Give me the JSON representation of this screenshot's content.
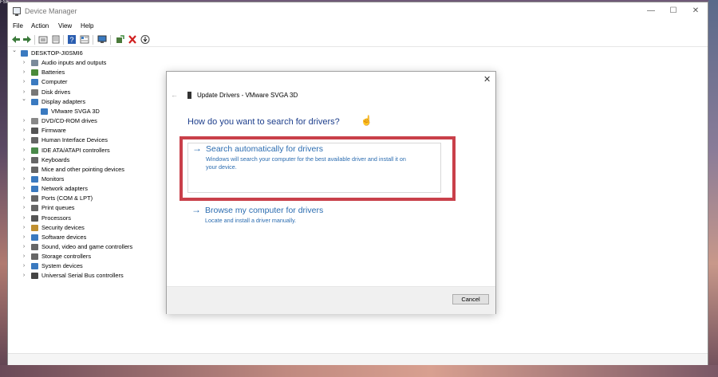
{
  "corner_label": "FSF",
  "window": {
    "title": "Device Manager",
    "minimize": "—",
    "maximize": "☐",
    "close": "✕"
  },
  "menu": [
    "File",
    "Action",
    "View",
    "Help"
  ],
  "toolbar_icons": [
    "back-arrow-icon",
    "forward-arrow-icon",
    "properties-icon",
    "list-icon",
    "help-icon",
    "details-icon",
    "monitor-icon",
    "update-driver-icon",
    "uninstall-icon",
    "download-icon"
  ],
  "tree": {
    "root": "DESKTOP-JI0SMI6",
    "items": [
      {
        "label": "Audio inputs and outputs",
        "icon": "speaker-icon",
        "color": "#7a8a9a",
        "expanded": false
      },
      {
        "label": "Batteries",
        "icon": "battery-icon",
        "color": "#4a8a3a",
        "expanded": false
      },
      {
        "label": "Computer",
        "icon": "computer-icon",
        "color": "#3a7ac0",
        "expanded": false
      },
      {
        "label": "Disk drives",
        "icon": "disk-icon",
        "color": "#777777",
        "expanded": false
      },
      {
        "label": "Display adapters",
        "icon": "display-icon",
        "color": "#3a7ac0",
        "expanded": true
      },
      {
        "label": "VMware SVGA 3D",
        "icon": "display-icon",
        "color": "#3a7ac0",
        "child": true
      },
      {
        "label": "DVD/CD-ROM drives",
        "icon": "dvd-icon",
        "color": "#888888",
        "expanded": false
      },
      {
        "label": "Firmware",
        "icon": "chip-icon",
        "color": "#555555",
        "expanded": false
      },
      {
        "label": "Human Interface Devices",
        "icon": "hid-icon",
        "color": "#666666",
        "expanded": false
      },
      {
        "label": "IDE ATA/ATAPI controllers",
        "icon": "controller-icon",
        "color": "#4a8a4a",
        "expanded": false
      },
      {
        "label": "Keyboards",
        "icon": "keyboard-icon",
        "color": "#666666",
        "expanded": false
      },
      {
        "label": "Mice and other pointing devices",
        "icon": "mouse-icon",
        "color": "#666666",
        "expanded": false
      },
      {
        "label": "Monitors",
        "icon": "monitor-icon",
        "color": "#3a7ac0",
        "expanded": false
      },
      {
        "label": "Network adapters",
        "icon": "network-icon",
        "color": "#3a7ac0",
        "expanded": false
      },
      {
        "label": "Ports (COM & LPT)",
        "icon": "port-icon",
        "color": "#666666",
        "expanded": false
      },
      {
        "label": "Print queues",
        "icon": "printer-icon",
        "color": "#666666",
        "expanded": false
      },
      {
        "label": "Processors",
        "icon": "cpu-icon",
        "color": "#555555",
        "expanded": false
      },
      {
        "label": "Security devices",
        "icon": "security-icon",
        "color": "#c09030",
        "expanded": false
      },
      {
        "label": "Software devices",
        "icon": "software-icon",
        "color": "#3a7ac0",
        "expanded": false
      },
      {
        "label": "Sound, video and game controllers",
        "icon": "sound-icon",
        "color": "#666666",
        "expanded": false
      },
      {
        "label": "Storage controllers",
        "icon": "storage-icon",
        "color": "#666666",
        "expanded": false
      },
      {
        "label": "System devices",
        "icon": "system-icon",
        "color": "#3a7ac0",
        "expanded": false
      },
      {
        "label": "Universal Serial Bus controllers",
        "icon": "usb-icon",
        "color": "#444444",
        "expanded": false
      }
    ]
  },
  "dialog": {
    "close": "✕",
    "back": "←",
    "title": "Update Drivers - VMware SVGA 3D",
    "question": "How do you want to search for drivers?",
    "option1": {
      "arrow": "→",
      "title": "Search automatically for drivers",
      "desc_line1": "Windows will search your computer for the best available driver and install it on",
      "desc_line2": "your device."
    },
    "option2": {
      "arrow": "→",
      "title": "Browse my computer for drivers",
      "desc": "Locate and install a driver manually."
    },
    "cancel": "Cancel",
    "highlight_color": "#c9404a"
  }
}
